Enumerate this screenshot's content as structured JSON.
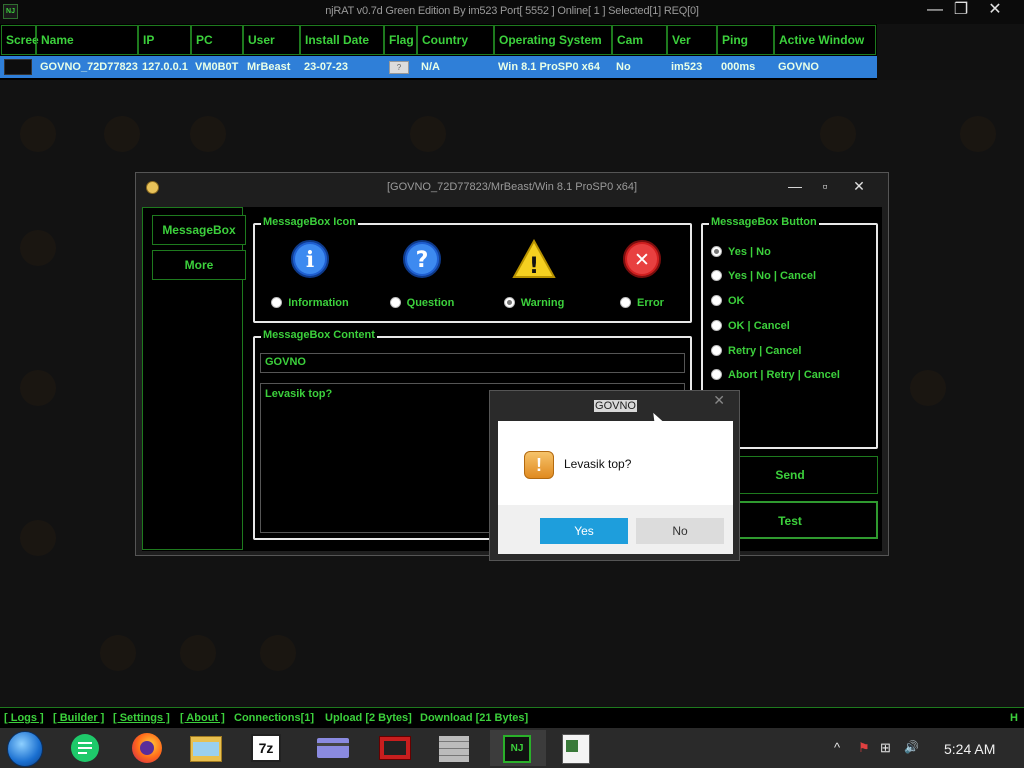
{
  "app": {
    "title": "njRAT v0.7d Green Edition By im523    Port[ 5552 ]    Online[ 1 ]    Selected[1] REQ[0]",
    "icon_label": "NJ",
    "minimize_glyph": "—",
    "maximize_glyph": "❐",
    "close_glyph": "✕"
  },
  "grid": {
    "columns": [
      "Scree",
      "Name",
      "IP",
      "PC",
      "User",
      "Install Date",
      "Flag",
      "Country",
      "Operating System",
      "Cam",
      "Ver",
      "Ping",
      "Active Window"
    ],
    "row": {
      "name": "GOVNO_72D77823",
      "ip": "127.0.0.1",
      "pc": "VM0B0T",
      "user": "MrBeast",
      "install_date": "23-07-23",
      "flag": "?",
      "country": "N/A",
      "os": "Win 8.1 ProSP0 x64",
      "cam": "No",
      "ver": "im523",
      "ping": "000ms",
      "active_window": "GOVNO"
    }
  },
  "window": {
    "title": "[GOVNO_72D77823/MrBeast/Win 8.1 ProSP0 x64]",
    "minimize_glyph": "—",
    "maximize_glyph": "▫",
    "close_glyph": "✕",
    "side_tabs": [
      "MessageBox",
      "More"
    ],
    "icon_group": {
      "label": "MessageBox Icon",
      "options": [
        {
          "label": "Information",
          "glyph": "i",
          "selected": false
        },
        {
          "label": "Question",
          "glyph": "?",
          "selected": false
        },
        {
          "label": "Warning",
          "glyph": "!",
          "selected": true
        },
        {
          "label": "Error",
          "glyph": "✕",
          "selected": false
        }
      ]
    },
    "content_group": {
      "label": "MessageBox Content",
      "title_value": "GOVNO",
      "message_value": "Levasik top?"
    },
    "button_group": {
      "label": "MessageBox Button",
      "options": [
        {
          "label": "Yes | No",
          "selected": true
        },
        {
          "label": "Yes | No | Cancel",
          "selected": false
        },
        {
          "label": "OK",
          "selected": false
        },
        {
          "label": "OK | Cancel",
          "selected": false
        },
        {
          "label": "Retry | Cancel",
          "selected": false
        },
        {
          "label": "Abort | Retry | Cancel",
          "selected": false
        }
      ]
    },
    "send_label": "Send",
    "test_label": "Test"
  },
  "dialog": {
    "title": "GOVNO",
    "close_glyph": "✕",
    "icon_glyph": "!",
    "message": "Levasik top?",
    "yes_label": "Yes",
    "no_label": "No"
  },
  "statusbar": {
    "logs": "[ Logs ]",
    "builder": "[ Builder ]",
    "settings": "[ Settings ]",
    "about": "[ About ]",
    "connections": "Connections[1]",
    "upload": "Upload [2 Bytes]",
    "download": "Download [21 Bytes]",
    "right_char": "H"
  },
  "taskbar": {
    "apps": [
      "start-orb",
      "notes-app",
      "firefox",
      "file-explorer",
      "7zip",
      "card-app",
      "media-app",
      "wall-app",
      "njrat",
      "document-app"
    ],
    "sevenzip_label": "7z",
    "njrat_label": "NJ",
    "tray": {
      "chevron": "^",
      "flag": "⚑",
      "network": "⊞",
      "volume": "🔊",
      "time": "5:24 AM"
    }
  },
  "colors": {
    "accent_green": "#3cd03c",
    "selection_blue": "#2f7fd8",
    "dialog_yes_blue": "#1e9edc"
  }
}
